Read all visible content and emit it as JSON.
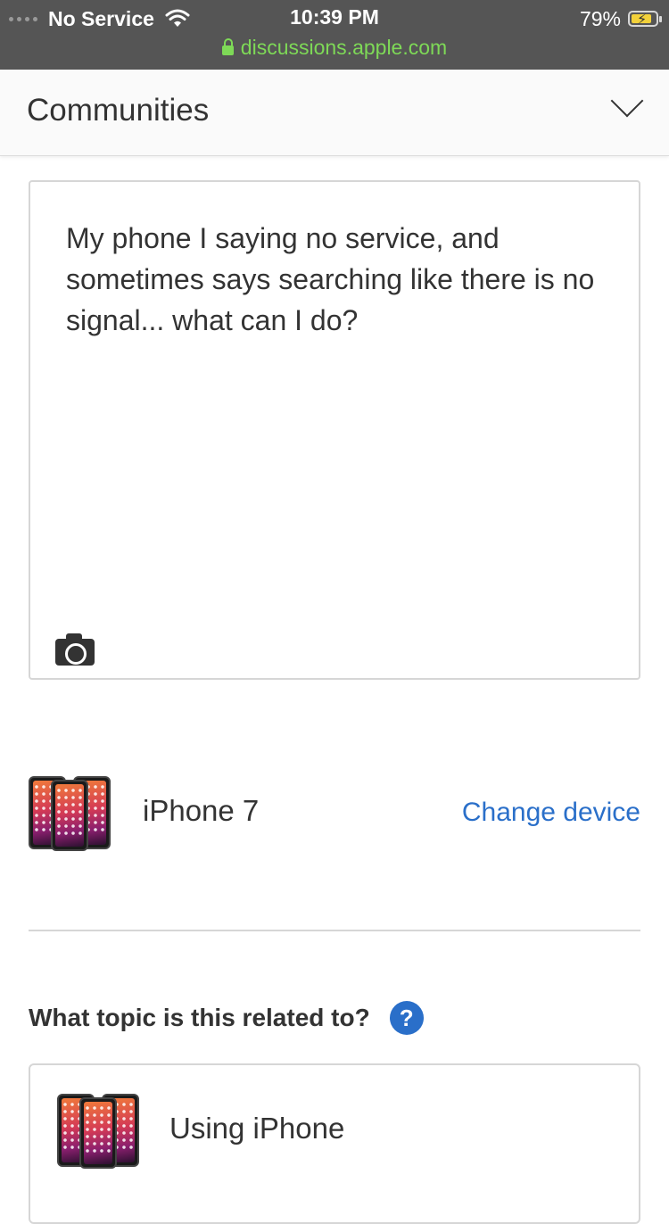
{
  "status_bar": {
    "carrier": "No Service",
    "time": "10:39 PM",
    "battery": "79%",
    "battery_level": 0.79,
    "url": "discussions.apple.com"
  },
  "header": {
    "title": "Communities"
  },
  "question": {
    "text": "My phone I saying no service, and sometimes says searching like there is no signal... what can I do?"
  },
  "device": {
    "name": "iPhone 7",
    "change_label": "Change device"
  },
  "topic": {
    "question": "What topic is this related to?",
    "help_symbol": "?",
    "selected": "Using iPhone"
  },
  "colors": {
    "link": "#2a6fc9",
    "status_bar_bg": "#555555",
    "url_green": "#7ed957"
  }
}
